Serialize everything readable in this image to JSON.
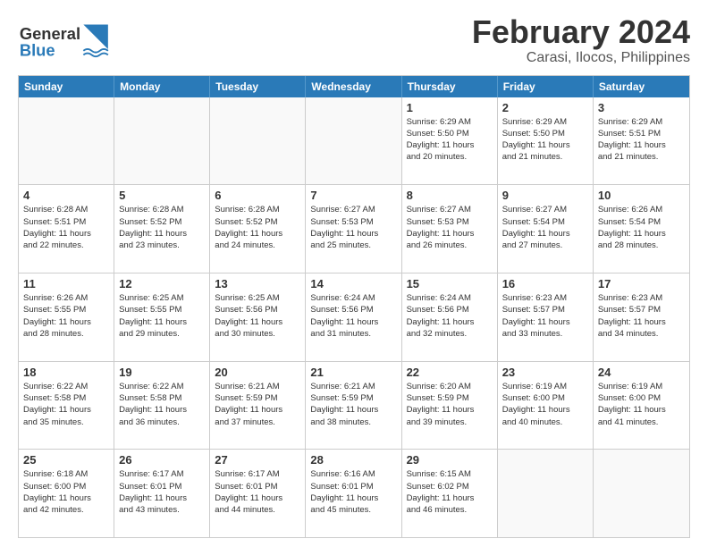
{
  "header": {
    "logo_text_general": "General",
    "logo_text_blue": "Blue",
    "title": "February 2024",
    "subtitle": "Carasi, Ilocos, Philippines"
  },
  "calendar": {
    "days_of_week": [
      "Sunday",
      "Monday",
      "Tuesday",
      "Wednesday",
      "Thursday",
      "Friday",
      "Saturday"
    ],
    "weeks": [
      [
        {
          "day": "",
          "info": ""
        },
        {
          "day": "",
          "info": ""
        },
        {
          "day": "",
          "info": ""
        },
        {
          "day": "",
          "info": ""
        },
        {
          "day": "1",
          "info": "Sunrise: 6:29 AM\nSunset: 5:50 PM\nDaylight: 11 hours\nand 20 minutes."
        },
        {
          "day": "2",
          "info": "Sunrise: 6:29 AM\nSunset: 5:50 PM\nDaylight: 11 hours\nand 21 minutes."
        },
        {
          "day": "3",
          "info": "Sunrise: 6:29 AM\nSunset: 5:51 PM\nDaylight: 11 hours\nand 21 minutes."
        }
      ],
      [
        {
          "day": "4",
          "info": "Sunrise: 6:28 AM\nSunset: 5:51 PM\nDaylight: 11 hours\nand 22 minutes."
        },
        {
          "day": "5",
          "info": "Sunrise: 6:28 AM\nSunset: 5:52 PM\nDaylight: 11 hours\nand 23 minutes."
        },
        {
          "day": "6",
          "info": "Sunrise: 6:28 AM\nSunset: 5:52 PM\nDaylight: 11 hours\nand 24 minutes."
        },
        {
          "day": "7",
          "info": "Sunrise: 6:27 AM\nSunset: 5:53 PM\nDaylight: 11 hours\nand 25 minutes."
        },
        {
          "day": "8",
          "info": "Sunrise: 6:27 AM\nSunset: 5:53 PM\nDaylight: 11 hours\nand 26 minutes."
        },
        {
          "day": "9",
          "info": "Sunrise: 6:27 AM\nSunset: 5:54 PM\nDaylight: 11 hours\nand 27 minutes."
        },
        {
          "day": "10",
          "info": "Sunrise: 6:26 AM\nSunset: 5:54 PM\nDaylight: 11 hours\nand 28 minutes."
        }
      ],
      [
        {
          "day": "11",
          "info": "Sunrise: 6:26 AM\nSunset: 5:55 PM\nDaylight: 11 hours\nand 28 minutes."
        },
        {
          "day": "12",
          "info": "Sunrise: 6:25 AM\nSunset: 5:55 PM\nDaylight: 11 hours\nand 29 minutes."
        },
        {
          "day": "13",
          "info": "Sunrise: 6:25 AM\nSunset: 5:56 PM\nDaylight: 11 hours\nand 30 minutes."
        },
        {
          "day": "14",
          "info": "Sunrise: 6:24 AM\nSunset: 5:56 PM\nDaylight: 11 hours\nand 31 minutes."
        },
        {
          "day": "15",
          "info": "Sunrise: 6:24 AM\nSunset: 5:56 PM\nDaylight: 11 hours\nand 32 minutes."
        },
        {
          "day": "16",
          "info": "Sunrise: 6:23 AM\nSunset: 5:57 PM\nDaylight: 11 hours\nand 33 minutes."
        },
        {
          "day": "17",
          "info": "Sunrise: 6:23 AM\nSunset: 5:57 PM\nDaylight: 11 hours\nand 34 minutes."
        }
      ],
      [
        {
          "day": "18",
          "info": "Sunrise: 6:22 AM\nSunset: 5:58 PM\nDaylight: 11 hours\nand 35 minutes."
        },
        {
          "day": "19",
          "info": "Sunrise: 6:22 AM\nSunset: 5:58 PM\nDaylight: 11 hours\nand 36 minutes."
        },
        {
          "day": "20",
          "info": "Sunrise: 6:21 AM\nSunset: 5:59 PM\nDaylight: 11 hours\nand 37 minutes."
        },
        {
          "day": "21",
          "info": "Sunrise: 6:21 AM\nSunset: 5:59 PM\nDaylight: 11 hours\nand 38 minutes."
        },
        {
          "day": "22",
          "info": "Sunrise: 6:20 AM\nSunset: 5:59 PM\nDaylight: 11 hours\nand 39 minutes."
        },
        {
          "day": "23",
          "info": "Sunrise: 6:19 AM\nSunset: 6:00 PM\nDaylight: 11 hours\nand 40 minutes."
        },
        {
          "day": "24",
          "info": "Sunrise: 6:19 AM\nSunset: 6:00 PM\nDaylight: 11 hours\nand 41 minutes."
        }
      ],
      [
        {
          "day": "25",
          "info": "Sunrise: 6:18 AM\nSunset: 6:00 PM\nDaylight: 11 hours\nand 42 minutes."
        },
        {
          "day": "26",
          "info": "Sunrise: 6:17 AM\nSunset: 6:01 PM\nDaylight: 11 hours\nand 43 minutes."
        },
        {
          "day": "27",
          "info": "Sunrise: 6:17 AM\nSunset: 6:01 PM\nDaylight: 11 hours\nand 44 minutes."
        },
        {
          "day": "28",
          "info": "Sunrise: 6:16 AM\nSunset: 6:01 PM\nDaylight: 11 hours\nand 45 minutes."
        },
        {
          "day": "29",
          "info": "Sunrise: 6:15 AM\nSunset: 6:02 PM\nDaylight: 11 hours\nand 46 minutes."
        },
        {
          "day": "",
          "info": ""
        },
        {
          "day": "",
          "info": ""
        }
      ]
    ]
  }
}
